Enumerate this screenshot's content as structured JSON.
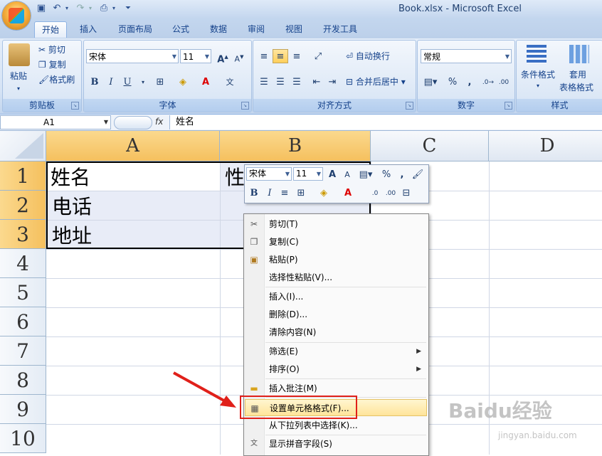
{
  "window": {
    "title": "Book.xlsx - Microsoft Excel"
  },
  "tabs": [
    "开始",
    "插入",
    "页面布局",
    "公式",
    "数据",
    "审阅",
    "视图",
    "开发工具"
  ],
  "ribbon": {
    "clipboard": {
      "label": "剪贴板",
      "paste": "粘贴",
      "cut": "剪切",
      "copy": "复制",
      "format_painter": "格式刷"
    },
    "font": {
      "label": "字体",
      "font_name": "宋体",
      "font_size": "11",
      "bold": "B",
      "italic": "I",
      "underline": "U"
    },
    "alignment": {
      "label": "对齐方式",
      "wrap_text": "自动换行",
      "merge_center": "合并后居中"
    },
    "number": {
      "label": "数字",
      "format": "常规",
      "percent": "%",
      "comma": ","
    },
    "styles": {
      "label": "样式",
      "conditional_format": "条件格式",
      "table_format_1": "套用",
      "table_format_2": "表格格式"
    }
  },
  "formula_bar": {
    "name_box": "A1",
    "fx": "fx",
    "content": "姓名"
  },
  "grid": {
    "columns": [
      "A",
      "B",
      "C",
      "D"
    ],
    "rows": [
      "1",
      "2",
      "3",
      "4",
      "5",
      "6",
      "7",
      "8",
      "9",
      "10"
    ],
    "cells": {
      "A1": "姓名",
      "B1_partial": "性",
      "A2": "电话",
      "A3": "地址"
    }
  },
  "mini_toolbar": {
    "font_name": "宋体",
    "font_size": "11",
    "percent": "%",
    "comma": ","
  },
  "context_menu": {
    "items": [
      "剪切(T)",
      "复制(C)",
      "粘贴(P)",
      "选择性粘贴(V)...",
      "插入(I)...",
      "删除(D)...",
      "清除内容(N)",
      "筛选(E)",
      "排序(O)",
      "插入批注(M)",
      "设置单元格格式(F)...",
      "从下拉列表中选择(K)...",
      "显示拼音字段(S)"
    ],
    "highlighted": "设置单元格格式(F)..."
  },
  "watermark": {
    "brand": "Baidu经验",
    "url": "jingyan.baidu.com"
  },
  "colors": {
    "accent": "#15428b",
    "highlight": "#ffe49a",
    "annotation": "#e0201a",
    "selected_header": "#f5c05e"
  }
}
